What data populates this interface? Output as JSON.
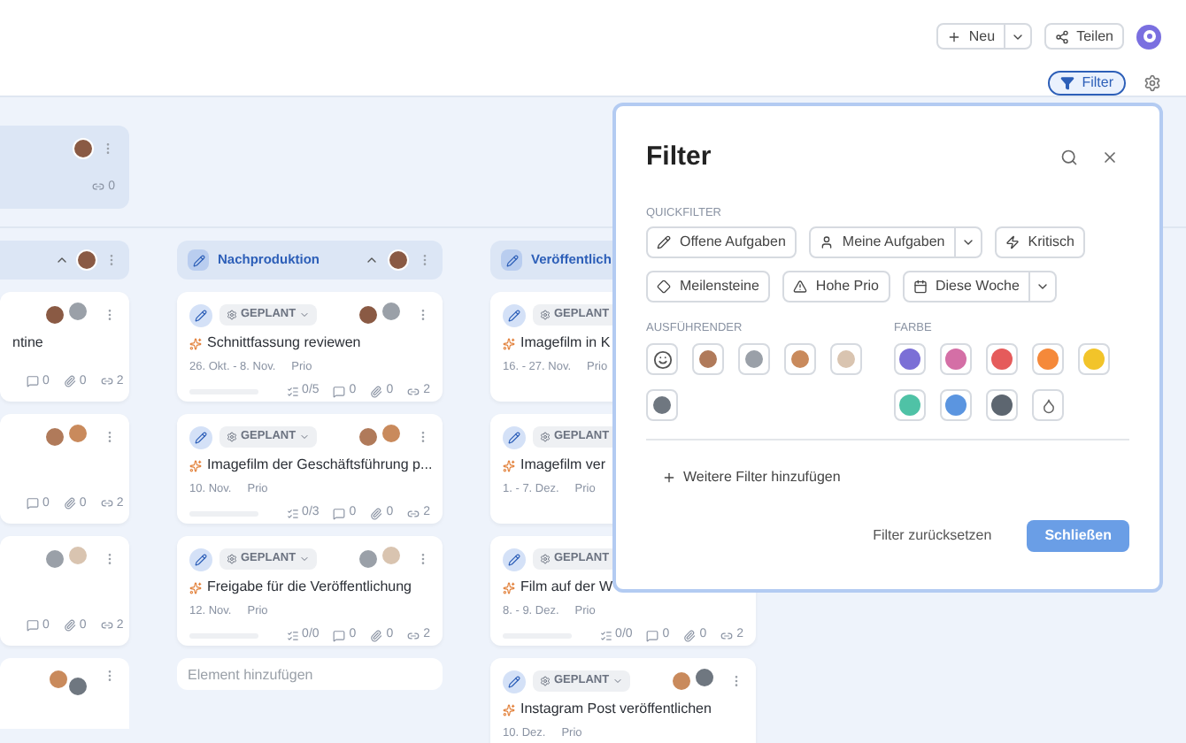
{
  "toolbar": {
    "new_button": "Neu",
    "share_button": "Teilen",
    "filter_button": "Filter"
  },
  "board": {
    "group_card": {
      "links": "0"
    },
    "columns": [
      {
        "cards": [
          {
            "title": "ntine",
            "comments": "0",
            "attachments": "0",
            "links": "2"
          },
          {
            "comments": "0",
            "attachments": "0",
            "links": "2"
          },
          {
            "comments": "0",
            "attachments": "0",
            "links": "2"
          }
        ],
        "has_more_card": true
      },
      {
        "title": "Nachproduktion",
        "add_item_placeholder": "Element hinzufügen",
        "cards": [
          {
            "status": "GEPLANT",
            "title": "Schnittfassung reviewen",
            "date": "26. Okt. - 8. Nov.",
            "prio": "Prio",
            "level": 0,
            "subtasks": "0/5",
            "comments": "0",
            "attachments": "0",
            "links": "2"
          },
          {
            "status": "GEPLANT",
            "title": "Imagefilm der Geschäftsführung p...",
            "date": "10. Nov.",
            "prio": "Prio",
            "level": 0,
            "subtasks": "0/3",
            "comments": "0",
            "attachments": "0",
            "links": "2"
          },
          {
            "status": "GEPLANT",
            "title": "Freigabe für die Veröffentlichung",
            "date": "12. Nov.",
            "prio": "Prio",
            "level": 0,
            "subtasks": "0/0",
            "comments": "0",
            "attachments": "0",
            "links": "2"
          }
        ]
      },
      {
        "title": "Veröffentlich",
        "cards": [
          {
            "status": "GEPLANT",
            "title": "Imagefilm in K",
            "date": "16. - 27. Nov.",
            "prio": "Prio"
          },
          {
            "status": "GEPLANT",
            "title": "Imagefilm ver",
            "date": "1. - 7. Dez.",
            "prio": "Prio"
          },
          {
            "status": "GEPLANT",
            "title": "Film auf der W",
            "date": "8. - 9. Dez.",
            "prio": "Prio",
            "level": 0,
            "subtasks": "0/0",
            "comments": "0",
            "attachments": "0",
            "links": "2"
          },
          {
            "status": "GEPLANT",
            "title": "Instagram Post veröffentlichen",
            "date": "10. Dez.",
            "prio": "Prio"
          }
        ]
      }
    ]
  },
  "filter_panel": {
    "title": "Filter",
    "quickfilter_label": "QUICKFILTER",
    "quickfilters": [
      {
        "label": "Offene Aufgaben",
        "has_menu": false
      },
      {
        "label": "Meine Aufgaben",
        "has_menu": true
      },
      {
        "label": "Kritisch",
        "has_menu": false
      },
      {
        "label": "Meilensteine",
        "has_menu": false
      },
      {
        "label": "Hohe Prio",
        "has_menu": false
      },
      {
        "label": "Diese Woche",
        "has_menu": true
      }
    ],
    "assignee_label": "AUSFÜHRENDER",
    "assignees": [
      {
        "kind": "unassigned"
      },
      {
        "kind": "person"
      },
      {
        "kind": "person"
      },
      {
        "kind": "person"
      },
      {
        "kind": "person"
      },
      {
        "kind": "person"
      }
    ],
    "color_label": "FARBE",
    "colors": [
      {
        "kind": "color",
        "color": "#7b6fd6"
      },
      {
        "kind": "color",
        "color": "#d46fa6"
      },
      {
        "kind": "color",
        "color": "#e55b5b"
      },
      {
        "kind": "color",
        "color": "#f5893a"
      },
      {
        "kind": "color",
        "color": "#f2c42a"
      },
      {
        "kind": "color",
        "color": "#4fc2a6"
      },
      {
        "kind": "color",
        "color": "#5b95e0"
      },
      {
        "kind": "color",
        "color": "#5d6670"
      },
      {
        "kind": "none"
      }
    ],
    "add_filter": "Weitere Filter hinzufügen",
    "reset_button": "Filter zurücksetzen",
    "close_button": "Schließen"
  }
}
